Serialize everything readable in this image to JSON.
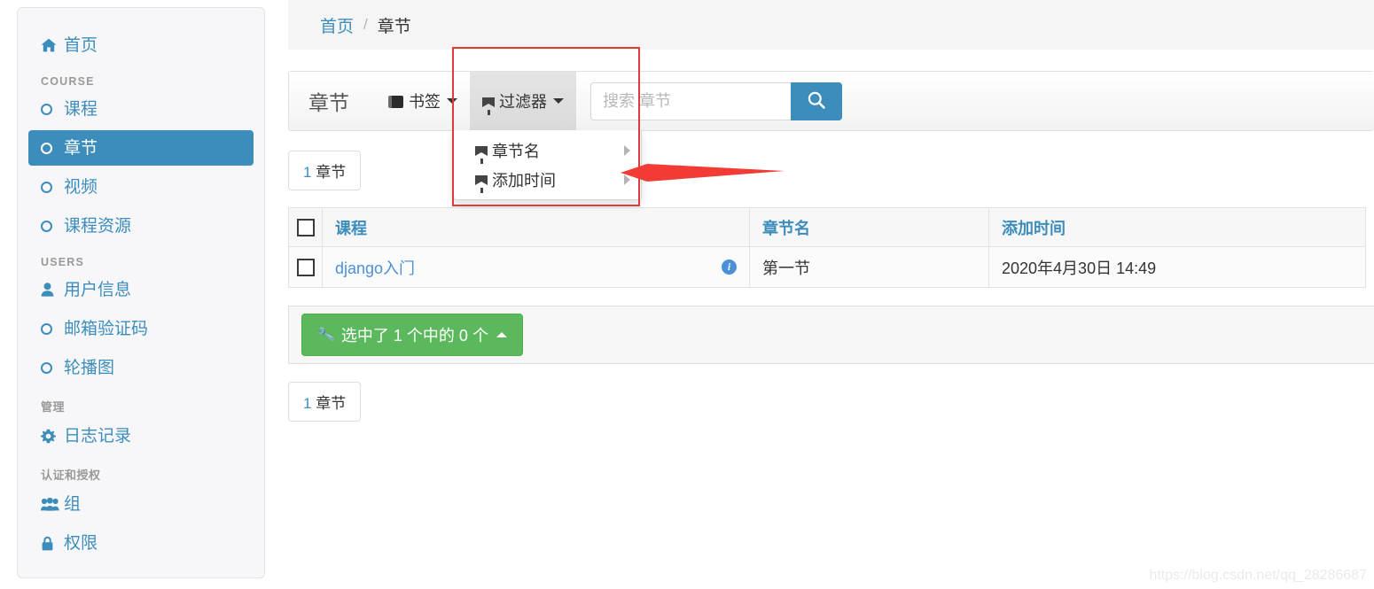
{
  "sidebar": {
    "items": [
      {
        "label": "首页",
        "icon": "home-icon",
        "type": "link",
        "active": false
      },
      {
        "label": "COURSE",
        "type": "header"
      },
      {
        "label": "课程",
        "icon": "circle-icon",
        "type": "link",
        "active": false
      },
      {
        "label": "章节",
        "icon": "circle-icon",
        "type": "link",
        "active": true
      },
      {
        "label": "视频",
        "icon": "circle-icon",
        "type": "link",
        "active": false
      },
      {
        "label": "课程资源",
        "icon": "circle-icon",
        "type": "link",
        "active": false
      },
      {
        "label": "USERS",
        "type": "header"
      },
      {
        "label": "用户信息",
        "icon": "user-icon",
        "type": "link",
        "active": false
      },
      {
        "label": "邮箱验证码",
        "icon": "circle-icon",
        "type": "link",
        "active": false
      },
      {
        "label": "轮播图",
        "icon": "circle-icon",
        "type": "link",
        "active": false
      },
      {
        "label": "管理",
        "type": "header"
      },
      {
        "label": "日志记录",
        "icon": "gear-icon",
        "type": "link",
        "active": false
      },
      {
        "label": "认证和授权",
        "type": "header"
      },
      {
        "label": "组",
        "icon": "users-group-icon",
        "type": "link",
        "active": false
      },
      {
        "label": "权限",
        "icon": "lock-icon",
        "type": "link",
        "active": false
      }
    ]
  },
  "breadcrumb": {
    "home": "首页",
    "separator": "/",
    "current": "章节"
  },
  "toolbar": {
    "title": "章节",
    "bookmark_label": "书签",
    "filter_label": "过滤器",
    "search_placeholder": "搜索 章节",
    "search_value": "",
    "search_icon": "magnifier-icon"
  },
  "filter_menu": {
    "items": [
      {
        "label": "章节名"
      },
      {
        "label": "添加时间"
      }
    ]
  },
  "count_badge": {
    "number": "1",
    "unit": "章节"
  },
  "table": {
    "headers": [
      "",
      "课程",
      "章节名",
      "添加时间"
    ],
    "rows": [
      {
        "checked": false,
        "course": "django入门",
        "info_icon": "info-icon",
        "chapter_name": "第一节",
        "added_time": "2020年4月30日 14:49"
      }
    ]
  },
  "actions": {
    "button_label": "选中了 1 个中的 0 个",
    "wrench_icon": "wrench-icon"
  },
  "watermark": "https://blog.csdn.net/qq_28286687",
  "colors": {
    "accent_blue": "#3c8dbc",
    "link_blue": "#4a90d9",
    "success_green": "#5cb85c",
    "annotation_red": "#e03b3b",
    "sidebar_bg": "#f7f7f9"
  }
}
